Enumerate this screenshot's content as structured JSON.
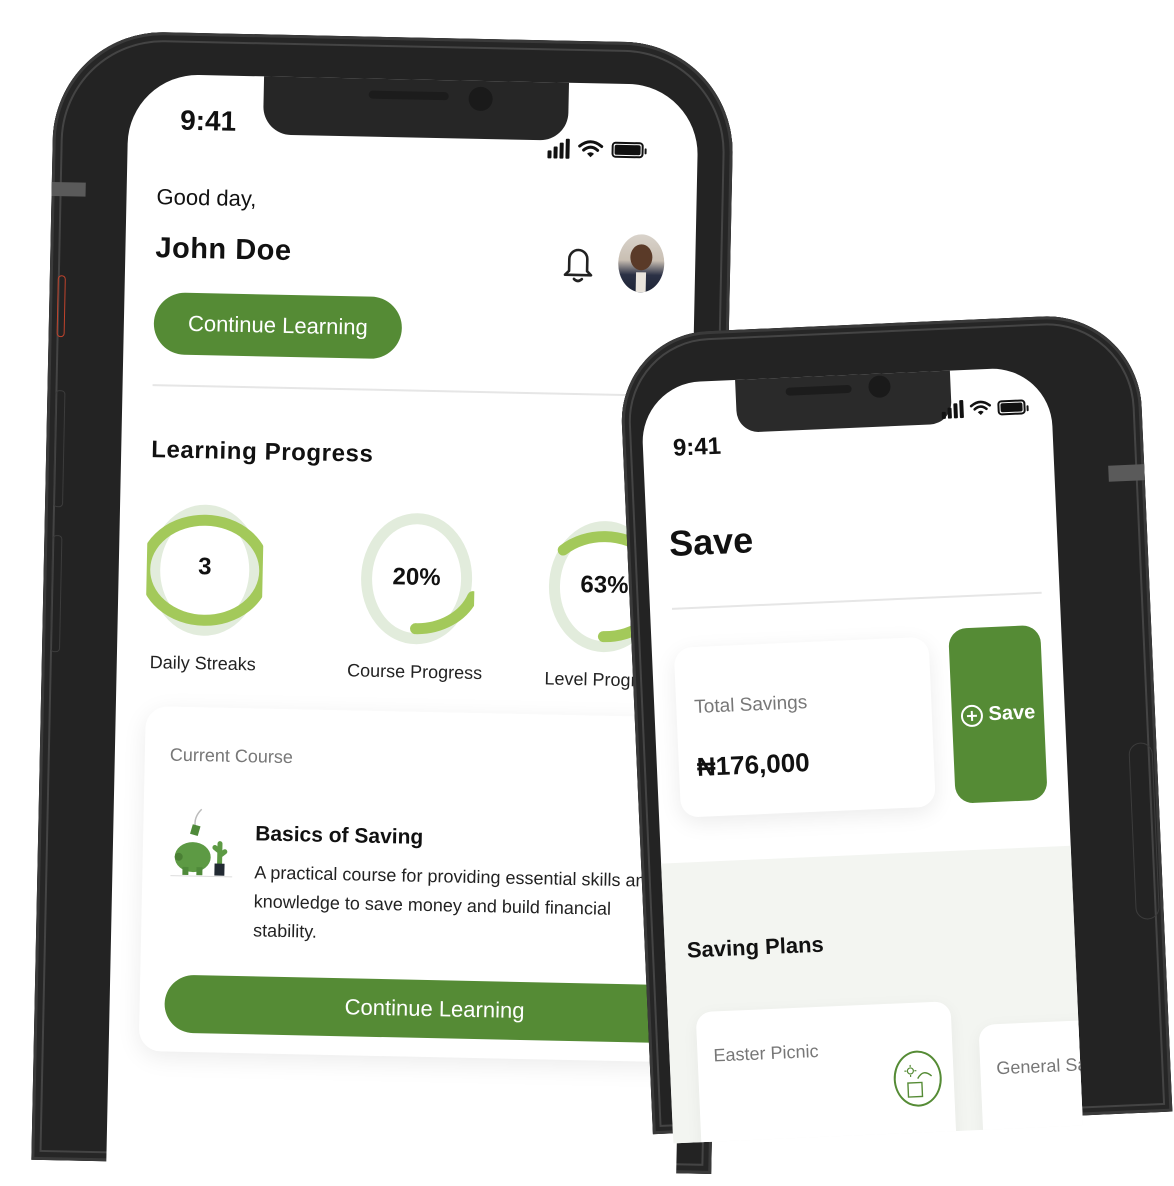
{
  "colors": {
    "accent": "#558b35",
    "ring": "#a3c95a",
    "ring_track": "#e2ecdc",
    "plans_bg": "#f3f5f1"
  },
  "home_screen": {
    "status_bar": {
      "time": "9:41",
      "icons": [
        "signal-icon",
        "wifi-icon",
        "battery-icon"
      ]
    },
    "greeting": "Good day,",
    "user_name": "John Doe",
    "header_icons": [
      "bell-icon",
      "avatar"
    ],
    "continue_button_label": "Continue Learning",
    "learning_progress": {
      "title": "Learning Progress",
      "metrics": [
        {
          "label": "Daily Streaks",
          "value": "3",
          "progress": 1.0
        },
        {
          "label": "Course Progress",
          "value": "20%",
          "progress": 0.2
        },
        {
          "label": "Level Progress",
          "value": "63%",
          "progress": 0.63
        }
      ]
    },
    "current_course": {
      "label": "Current Course",
      "title": "Basics of Saving",
      "description": "A practical course for providing essential skills and knowledge to save money and build financial stability.",
      "button_label": "Continue Learning",
      "illustration": "piggy-bank-icon"
    }
  },
  "save_screen": {
    "status_bar": {
      "time": "9:41",
      "icons": [
        "signal-icon",
        "wifi-icon",
        "battery-icon"
      ]
    },
    "title": "Save",
    "total_savings": {
      "label": "Total Savings",
      "amount": "₦176,000"
    },
    "save_button_label": "Save",
    "saving_plans": {
      "title": "Saving Plans",
      "plans": [
        {
          "label": "Easter Picnic",
          "icon": "picnic-icon"
        },
        {
          "label": "General Saving"
        }
      ]
    }
  }
}
